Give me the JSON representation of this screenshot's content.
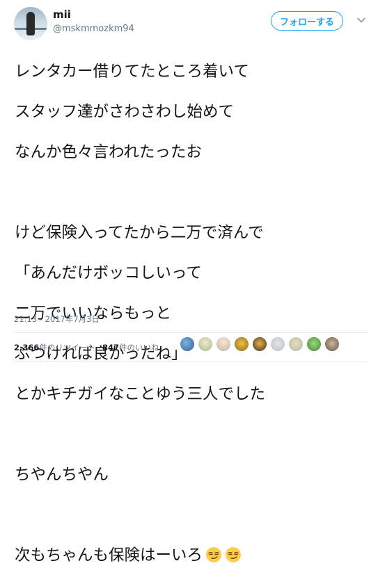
{
  "tweet": {
    "display_name": "mii",
    "handle": "@mskmmozkm94",
    "follow_label": "フォローする",
    "lines": [
      "レンタカー借りてたところ着いて",
      "スタッフ達がさわさわし始めて",
      "なんか色々言われたったお",
      "",
      "けど保険入ってたから二万で済んで",
      "「あんだけボッコしいって",
      "二万でいいならもっと",
      "ぶつければ良かったね」",
      "とかキチガイなことゆう三人でした",
      "",
      "ちやんちやん",
      "",
      "次もちゃんも保険はーいろ"
    ],
    "timestamp": "21:13 - 2017年7月3日",
    "retweets": {
      "count": "2,366",
      "label": "件のリツイート"
    },
    "likes": {
      "count": "847",
      "label": "件のいいね"
    }
  },
  "colors": {
    "accent": "#1da1f2",
    "secondary_text": "#657786",
    "divider": "#e6ecf0"
  },
  "icons": {
    "emoji": "smirking-face-icon",
    "menu": "chevron-down-icon"
  }
}
